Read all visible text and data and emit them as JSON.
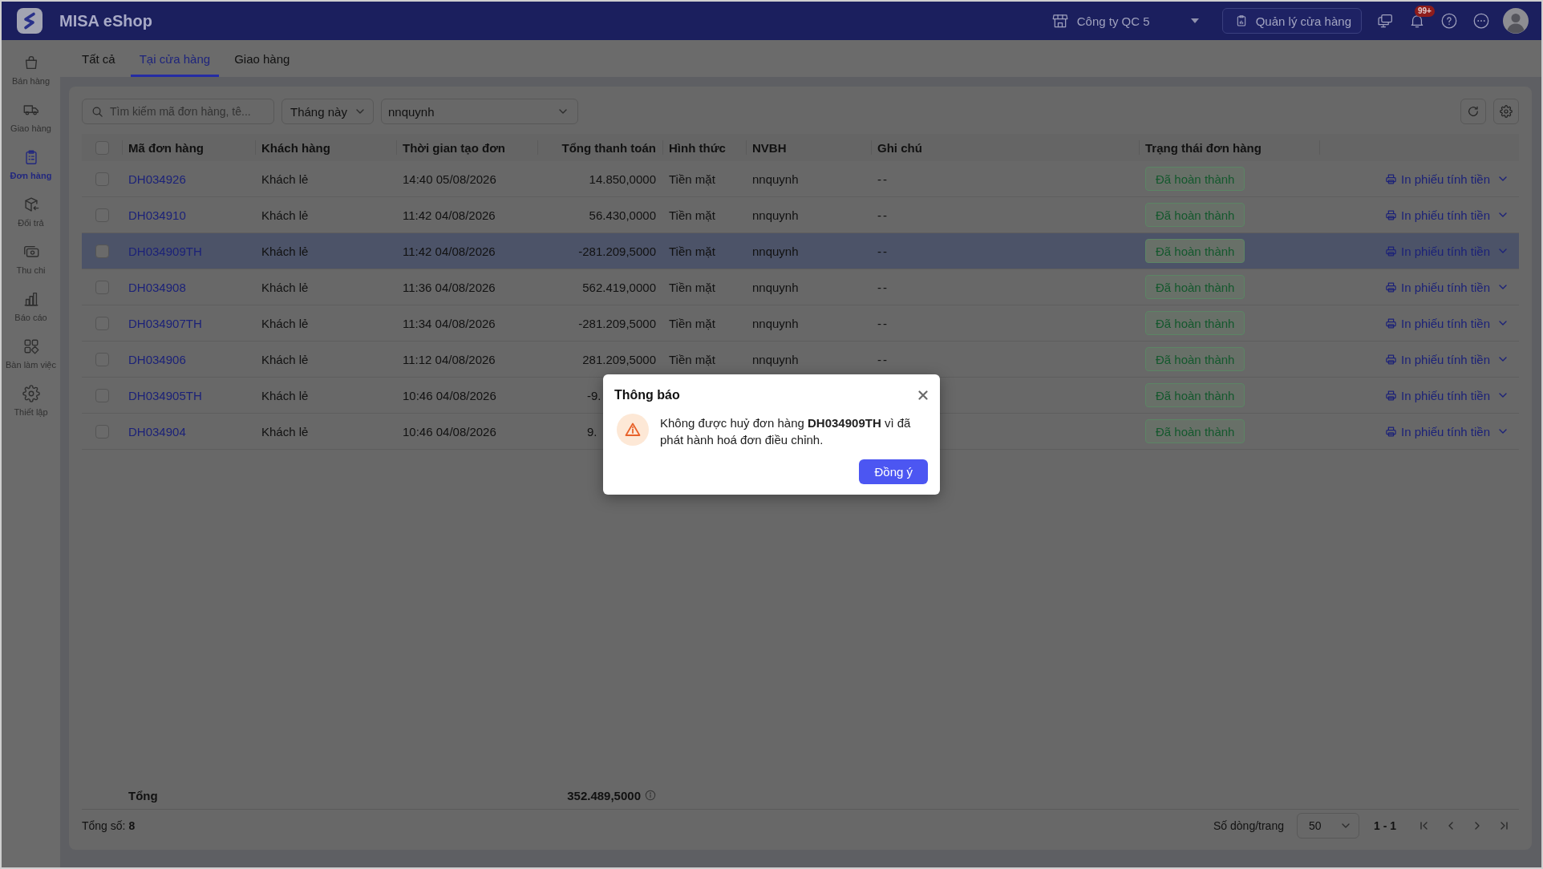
{
  "app": {
    "title": "MISA eShop",
    "company": "Công ty QC 5",
    "store_button": "Quản lý cửa hàng",
    "notification_badge": "99+"
  },
  "sidebar": {
    "items": [
      {
        "label": "Bán hàng",
        "selected": false
      },
      {
        "label": "Giao hàng",
        "selected": false
      },
      {
        "label": "Đơn hàng",
        "selected": true
      },
      {
        "label": "Đổi trả",
        "selected": false
      },
      {
        "label": "Thu chi",
        "selected": false
      },
      {
        "label": "Báo cáo",
        "selected": false
      },
      {
        "label": "Bàn làm việc",
        "selected": false
      },
      {
        "label": "Thiết lập",
        "selected": false
      }
    ]
  },
  "tabs": [
    {
      "label": "Tất cả",
      "selected": false
    },
    {
      "label": "Tại cửa hàng",
      "selected": true
    },
    {
      "label": "Giao hàng",
      "selected": false
    }
  ],
  "filters": {
    "search": {
      "placeholder": "Tìm kiếm mã đơn hàng, tê..."
    },
    "period": "Tháng này",
    "staff": "nnquynh"
  },
  "table": {
    "select_all_checked": false,
    "columns": [
      "Mã đơn hàng",
      "Khách hàng",
      "Thời gian tạo đơn",
      "Tổng thanh toán",
      "Hình thức",
      "NVBH",
      "Ghi chú",
      "Trạng thái đơn hàng"
    ],
    "rows": [
      {
        "checked": false,
        "selected": false,
        "order_id": "DH034926",
        "customer": "Khách lẻ",
        "created": "14:40 05/08/2026",
        "total": "14.850,0000",
        "payment": "Tiền mặt",
        "staff": "nnquynh",
        "note": "--",
        "status": "Đã hoàn thành",
        "action": "In phiếu tính tiền"
      },
      {
        "checked": false,
        "selected": false,
        "order_id": "DH034910",
        "customer": "Khách lẻ",
        "created": "11:42 04/08/2026",
        "total": "56.430,0000",
        "payment": "Tiền mặt",
        "staff": "nnquynh",
        "note": "--",
        "status": "Đã hoàn thành",
        "action": "In phiếu tính tiền"
      },
      {
        "checked": false,
        "selected": true,
        "order_id": "DH034909TH",
        "customer": "Khách lẻ",
        "created": "11:42 04/08/2026",
        "total": "-281.209,5000",
        "payment": "Tiền mặt",
        "staff": "nnquynh",
        "note": "--",
        "status": "Đã hoàn thành",
        "action": "In phiếu tính tiền"
      },
      {
        "checked": false,
        "selected": false,
        "order_id": "DH034908",
        "customer": "Khách lẻ",
        "created": "11:36 04/08/2026",
        "total": "562.419,0000",
        "payment": "Tiền mặt",
        "staff": "nnquynh",
        "note": "--",
        "status": "Đã hoàn thành",
        "action": "In phiếu tính tiền"
      },
      {
        "checked": false,
        "selected": false,
        "order_id": "DH034907TH",
        "customer": "Khách lẻ",
        "created": "11:34 04/08/2026",
        "total": "-281.209,5000",
        "payment": "Tiền mặt",
        "staff": "nnquynh",
        "note": "--",
        "status": "Đã hoàn thành",
        "action": "In phiếu tính tiền"
      },
      {
        "checked": false,
        "selected": false,
        "order_id": "DH034906",
        "customer": "Khách lẻ",
        "created": "11:12 04/08/2026",
        "total": "281.209,5000",
        "payment": "Tiền mặt",
        "staff": "nnquynh",
        "note": "--",
        "status": "Đã hoàn thành",
        "action": "In phiếu tính tiền"
      },
      {
        "checked": false,
        "selected": false,
        "order_id": "DH034905TH",
        "customer": "Khách lẻ",
        "created": "10:46 04/08/2026",
        "total": "-9.",
        "status": "Đã hoàn thành",
        "action": "In phiếu tính tiền"
      },
      {
        "checked": false,
        "selected": false,
        "order_id": "DH034904",
        "customer": "Khách lẻ",
        "created": "10:46 04/08/2026",
        "total": "9.",
        "status": "Đã hoàn thành",
        "action": "In phiếu tính tiền"
      }
    ],
    "summary": {
      "label": "Tổng",
      "total": "352.489,5000"
    }
  },
  "footer": {
    "count": "Tổng số: **8**",
    "page_size_label": "Số dòng/trang",
    "page_size": "50",
    "range": "1 - 1"
  },
  "dialog": {
    "title": "Thông báo",
    "message": "Không được huỷ đơn hàng **DH034909TH** vì đã phát hành hoá đơn điều chỉnh.",
    "confirm": "Đồng ý"
  }
}
